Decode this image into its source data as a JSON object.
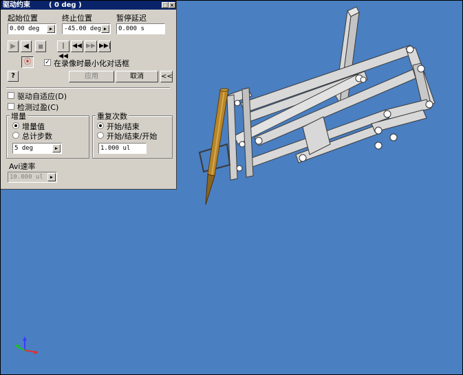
{
  "dialog": {
    "title": "驱动约束",
    "title_value": "( 0 deg )",
    "start_label": "起始位置",
    "start_value": "0.00 deg",
    "end_label": "终止位置",
    "end_value": "-45.00 deg",
    "pause_label": "暂停延迟",
    "pause_value": "0.000 s",
    "minimize_label": "在录像时最小化对话框",
    "minimize_checked": true,
    "apply_label": "应用",
    "cancel_label": "取消",
    "collapse_label": "<<",
    "help_label": "?",
    "adaptive_label": "驱动自适应(D)",
    "adaptive_checked": false,
    "interference_label": "检测过盈(C)",
    "interference_checked": false,
    "increment_group": "增量",
    "increment_value_label": "增量值",
    "total_steps_label": "总计步数",
    "increment_input": "5 deg",
    "repeat_group": "重复次数",
    "start_end_label": "开始/结束",
    "start_end_start_label": "开始/结束/开始",
    "repeat_input": "1.000 ul",
    "avi_label": "Avi速率",
    "avi_input": "10.000 ul"
  },
  "icons": [
    "play-forward-icon",
    "play-reverse-icon",
    "stop-icon",
    "go-start-icon",
    "step-back-icon",
    "step-forward-icon",
    "go-end-icon",
    "record-icon",
    "help-icon",
    "triad-icon"
  ],
  "colors": {
    "viewport": "#4a7fc1",
    "titlebar": "#0a246a",
    "dialog": "#d4d0c8",
    "pen": "#b8862a"
  }
}
